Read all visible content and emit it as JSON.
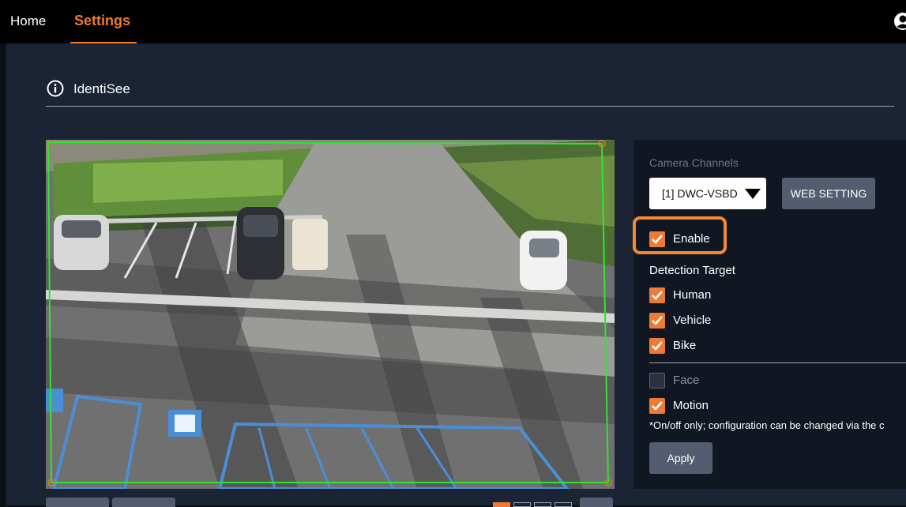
{
  "nav": {
    "home": "Home",
    "settings": "Settings",
    "user_icon": "user-icon"
  },
  "page": {
    "title": "IdentiSee",
    "title_icon": "info-icon"
  },
  "panel": {
    "channels_label": "Camera Channels",
    "channel_selected": "[1] DWC-VSBD",
    "web_setting": "WEB SETTING",
    "enable_label": "Enable",
    "enable_checked": true,
    "detection_target_label": "Detection Target",
    "targets": [
      {
        "label": "Human",
        "checked": true
      },
      {
        "label": "Vehicle",
        "checked": true
      },
      {
        "label": "Bike",
        "checked": true
      }
    ],
    "extras": [
      {
        "label": "Face",
        "checked": false
      },
      {
        "label": "Motion",
        "checked": true
      }
    ],
    "note": "*On/off only; configuration can be changed via the c",
    "apply": "Apply"
  },
  "colors": {
    "accent": "#ee7b35",
    "highlight": "#f28a35",
    "topbar": "#000000",
    "content_bg": "#1b2434",
    "panel_bg": "#111722",
    "button_bg": "#545d6f",
    "roi_outline": "#2ee62e"
  }
}
